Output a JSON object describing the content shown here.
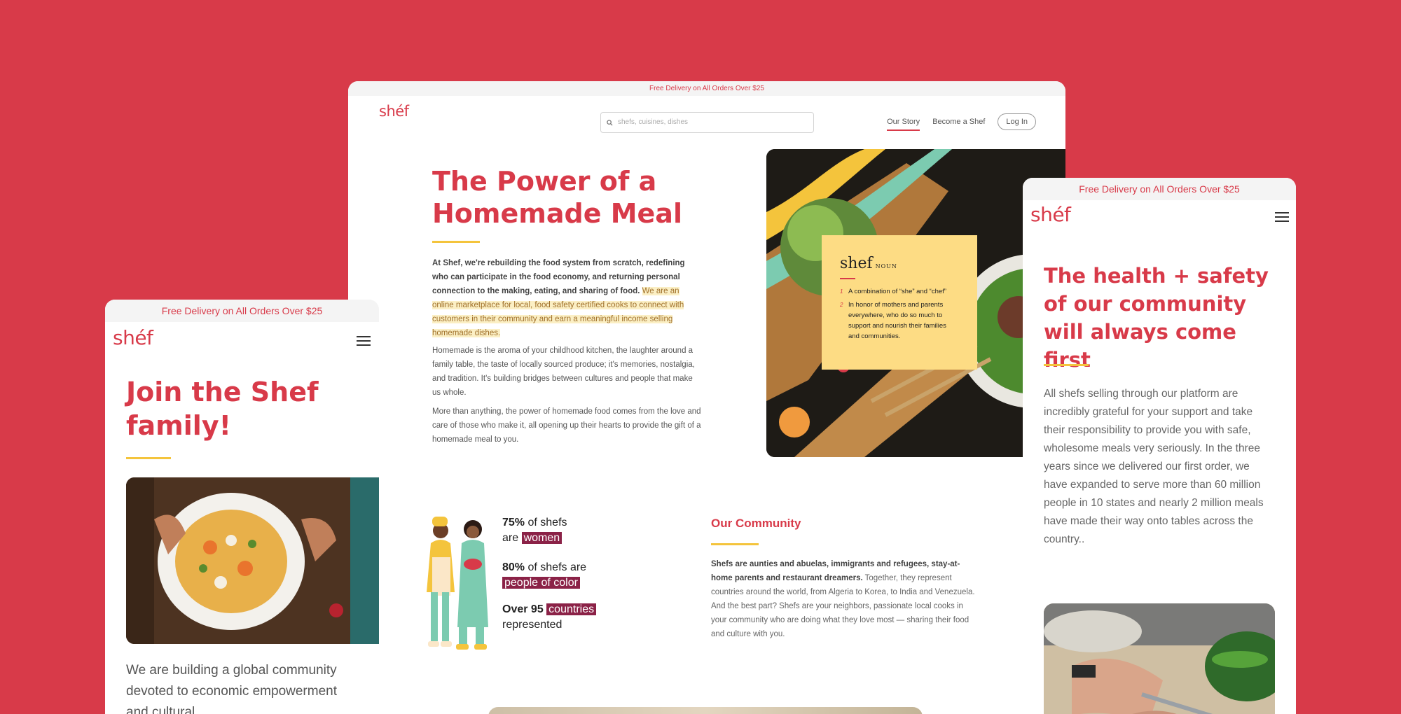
{
  "brand": {
    "logo": "shéf",
    "accent": "#d83a49",
    "highlight": "#f4c43c",
    "mark": "#8b2247"
  },
  "desktop": {
    "promo": "Free Delivery on All Orders Over $25",
    "search_placeholder": "shefs, cuisines, dishes",
    "nav": {
      "our_story": "Our Story",
      "become": "Become a Shef",
      "login": "Log In"
    },
    "hero_title": "The Power of a Homemade Meal",
    "p1_bold": "At Shef, we're rebuilding the food system from scratch, redefining who can participate in the food economy, and returning personal connection to the making, eating, and sharing of food.",
    "p1_highlight": "We are an online marketplace for local, food safety certified cooks to connect with customers in their community and earn a meaningful income selling homemade dishes.",
    "p2": "Homemade is the aroma of your childhood kitchen, the laughter around a family table, the taste of locally sourced produce; it's memories, nostalgia, and tradition. It's building bridges between cultures and people that make us whole.",
    "p3": "More than anything, the power of homemade food comes from the love and care of those who make it, all opening up their hearts to provide the gift of a homemade meal to you.",
    "definition": {
      "word": "shef",
      "pos": "NOUN",
      "items": [
        {
          "num": "1",
          "text": "A combination of “she” and “chef”"
        },
        {
          "num": "2",
          "text": "In honor of mothers and parents everywhere, who do so much to support and nourish their families and communities."
        }
      ]
    },
    "stats": [
      {
        "bold": "75%",
        "pre": " of shefs",
        "line2_pre": "are ",
        "mark": "women",
        "post": ""
      },
      {
        "bold": "80%",
        "pre": " of shefs are",
        "line2_pre": "",
        "mark": "people of color",
        "post": ""
      },
      {
        "bold": "Over 95",
        "pre": " ",
        "line2_pre": "",
        "mark": "countries",
        "post": "represented"
      }
    ],
    "community_title": "Our Community",
    "community_bold": "Shefs are aunties and abuelas, immigrants and refugees, stay-at-home parents and restaurant dreamers.",
    "community_rest": " Together, they represent countries around the world, from Algeria to Korea, to India and Venezuela. And the best part? Shefs are your neighbors, passionate local cooks in your community who are doing what they love most — sharing their food and culture with you."
  },
  "mobile_left": {
    "promo": "Free Delivery on All Orders Over $25",
    "title": "Join the Shef family!",
    "text": "We are building a global community devoted to economic empowerment and cultural"
  },
  "mobile_right": {
    "promo": "Free Delivery on All Orders Over $25",
    "title": "The health + safety of our community will always come first",
    "text": "All shefs selling through our platform are incredibly grateful for your support and take their responsibility to provide you with safe, wholesome meals very seriously. In the three years since we delivered our first order, we have expanded to serve more than 60 million people in 10 states and nearly 2 million meals have made their way onto tables across the country.."
  },
  "icons": {
    "search": "search-icon",
    "menu": "hamburger-menu-icon"
  }
}
